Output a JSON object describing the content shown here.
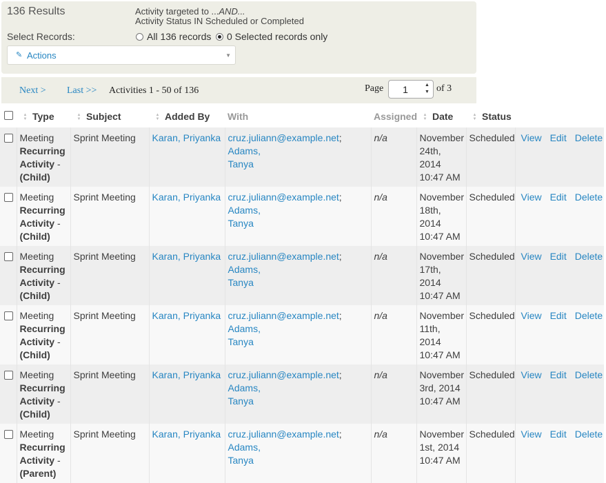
{
  "results": {
    "count_label": "136 Results",
    "criteria_line1_prefix": "Activity targeted to ...",
    "criteria_line1_and": "AND...",
    "criteria_line2": "Activity Status IN Scheduled or Completed",
    "select_label": "Select Records:",
    "radio_all": "All 136 records",
    "radio_selected": "0 Selected records only",
    "radio_checked": "selected",
    "actions_label": "Actions"
  },
  "pager": {
    "next": "Next >",
    "last": "Last >>",
    "range": "Activities 1 - 50 of 136",
    "page_label": "Page",
    "page_value": "1",
    "of_total": "of 3"
  },
  "table": {
    "columns": [
      "Type",
      "Subject",
      "Added By",
      "With",
      "Assigned",
      "Date",
      "Status"
    ],
    "rows": [
      {
        "type_top": "Meeting",
        "type_b1": "Recurring",
        "type_b2": "Activity",
        "type_suffix": " -",
        "type_b3": "(Child)",
        "subject": "Sprint Meeting",
        "added_by": "Karan, Priyanka",
        "with_email": "cruz.juliann@example.net",
        "with_sep": ";",
        "with_name1": "Adams,",
        "with_name2": "Tanya",
        "assigned": "n/a",
        "date1": "November",
        "date2": "24th, 2014",
        "date3": "10:47 AM",
        "status": "Scheduled",
        "view": "View",
        "edit": "Edit",
        "delete": "Delete"
      },
      {
        "type_top": "Meeting",
        "type_b1": "Recurring",
        "type_b2": "Activity",
        "type_suffix": " -",
        "type_b3": "(Child)",
        "subject": "Sprint Meeting",
        "added_by": "Karan, Priyanka",
        "with_email": "cruz.juliann@example.net",
        "with_sep": ";",
        "with_name1": "Adams,",
        "with_name2": "Tanya",
        "assigned": "n/a",
        "date1": "November",
        "date2": "18th, 2014",
        "date3": "10:47 AM",
        "status": "Scheduled",
        "view": "View",
        "edit": "Edit",
        "delete": "Delete"
      },
      {
        "type_top": "Meeting",
        "type_b1": "Recurring",
        "type_b2": "Activity",
        "type_suffix": " -",
        "type_b3": "(Child)",
        "subject": "Sprint Meeting",
        "added_by": "Karan, Priyanka",
        "with_email": "cruz.juliann@example.net",
        "with_sep": ";",
        "with_name1": "Adams,",
        "with_name2": "Tanya",
        "assigned": "n/a",
        "date1": "November",
        "date2": "17th, 2014",
        "date3": "10:47 AM",
        "status": "Scheduled",
        "view": "View",
        "edit": "Edit",
        "delete": "Delete"
      },
      {
        "type_top": "Meeting",
        "type_b1": "Recurring",
        "type_b2": "Activity",
        "type_suffix": " -",
        "type_b3": "(Child)",
        "subject": "Sprint Meeting",
        "added_by": "Karan, Priyanka",
        "with_email": "cruz.juliann@example.net",
        "with_sep": ";",
        "with_name1": "Adams,",
        "with_name2": "Tanya",
        "assigned": "n/a",
        "date1": "November",
        "date2": "11th, 2014",
        "date3": "10:47 AM",
        "status": "Scheduled",
        "view": "View",
        "edit": "Edit",
        "delete": "Delete"
      },
      {
        "type_top": "Meeting",
        "type_b1": "Recurring",
        "type_b2": "Activity",
        "type_suffix": " -",
        "type_b3": "(Child)",
        "subject": "Sprint Meeting",
        "added_by": "Karan, Priyanka",
        "with_email": "cruz.juliann@example.net",
        "with_sep": ";",
        "with_name1": "Adams,",
        "with_name2": "Tanya",
        "assigned": "n/a",
        "date1": "November",
        "date2": "3rd, 2014",
        "date3": "10:47 AM",
        "status": "Scheduled",
        "view": "View",
        "edit": "Edit",
        "delete": "Delete"
      },
      {
        "type_top": "Meeting",
        "type_b1": "Recurring",
        "type_b2": "Activity",
        "type_suffix": " -",
        "type_b3": "(Parent)",
        "subject": "Sprint Meeting",
        "added_by": "Karan, Priyanka",
        "with_email": "cruz.juliann@example.net",
        "with_sep": ";",
        "with_name1": "Adams,",
        "with_name2": "Tanya",
        "assigned": "n/a",
        "date1": "November",
        "date2": "1st, 2014",
        "date3": "10:47 AM",
        "status": "Scheduled",
        "view": "View",
        "edit": "Edit",
        "delete": "Delete"
      }
    ]
  }
}
